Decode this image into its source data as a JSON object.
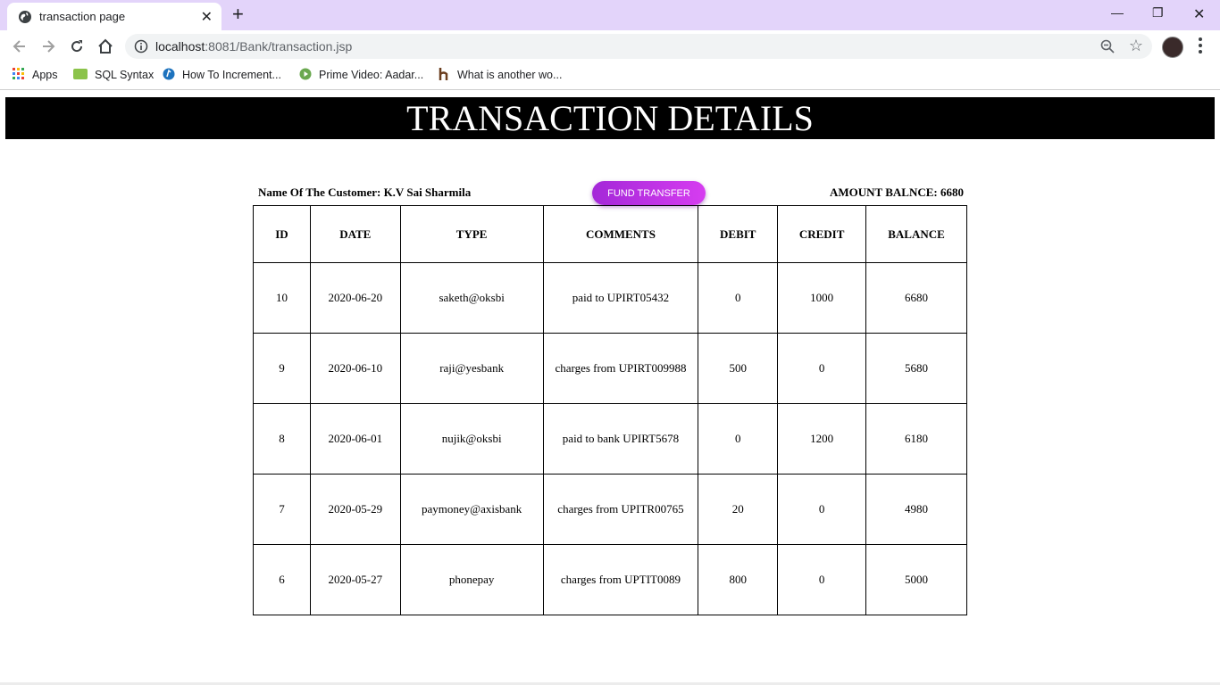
{
  "browser": {
    "tab_title": "transaction page",
    "url_host": "localhost",
    "url_path": ":8081/Bank/transaction.jsp",
    "bookmarks": [
      "Apps",
      "SQL Syntax",
      "How To Increment...",
      "Prime Video: Aadar...",
      "What is another wo..."
    ]
  },
  "page": {
    "title": "TRANSACTION DETAILS",
    "customer_label": "Name Of The Customer: K.V Sai Sharmila",
    "fund_button": "FUND TRANSFER",
    "balance_label": "AMOUNT BALNCE: 6680"
  },
  "table": {
    "headers": [
      "ID",
      "DATE",
      "TYPE",
      "COMMENTS",
      "DEBIT",
      "CREDIT",
      "BALANCE"
    ],
    "rows": [
      [
        "10",
        "2020-06-20",
        "saketh@oksbi",
        "paid to UPIRT05432",
        "0",
        "1000",
        "6680"
      ],
      [
        "9",
        "2020-06-10",
        "raji@yesbank",
        "charges from UPIRT009988",
        "500",
        "0",
        "5680"
      ],
      [
        "8",
        "2020-06-01",
        "nujik@oksbi",
        "paid to bank UPIRT5678",
        "0",
        "1200",
        "6180"
      ],
      [
        "7",
        "2020-05-29",
        "paymoney@axisbank",
        "charges from UPITR00765",
        "20",
        "0",
        "4980"
      ],
      [
        "6",
        "2020-05-27",
        "phonepay",
        "charges from UPTIT0089",
        "800",
        "0",
        "5000"
      ]
    ]
  },
  "colors": {
    "tabbar": "#e3d4fa",
    "banner": "#000000",
    "button_start": "#a428d8",
    "button_end": "#d63df0"
  }
}
